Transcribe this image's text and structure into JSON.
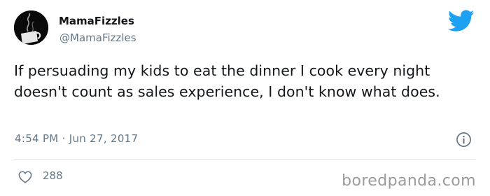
{
  "author": {
    "display_name": "MamaFizzles",
    "handle": "@MamaFizzles",
    "avatar_icon": "steaming-mug-icon"
  },
  "brand_icon": "twitter-bird-icon",
  "brand_color": "#1da1f2",
  "tweet": {
    "text": "If persuading my kids to eat the dinner I cook every night doesn't count as sales experience, I don't know what does.",
    "timestamp": "4:54 PM · Jun 27, 2017"
  },
  "info_icon": "info-icon",
  "engagement": {
    "like_icon": "heart-icon",
    "like_count": "288"
  },
  "watermark": "boredpanda.com"
}
